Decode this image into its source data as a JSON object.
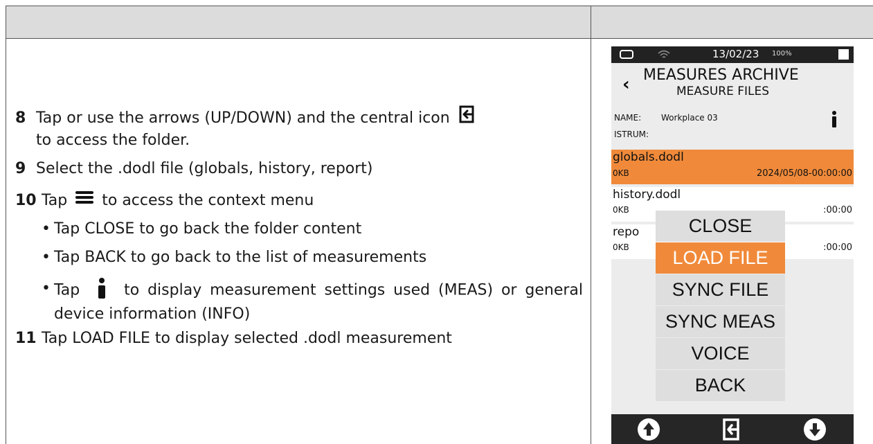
{
  "steps": [
    {
      "num": "8",
      "before": "Tap or use the arrows (UP/DOWN) and the central icon",
      "after": "to access the folder."
    },
    {
      "num": "9",
      "text": "Select the .dodl file (globals, history, report)"
    },
    {
      "num": "10",
      "before": "Tap",
      "after": "to access the context menu"
    },
    {
      "num": "11",
      "text": "Tap LOAD FILE to display selected .dodl measurement"
    }
  ],
  "substeps": {
    "close": "Tap CLOSE to go back the folder content",
    "back": "Tap BACK to go back to the list of measurements",
    "info_before": "Tap",
    "info_after": "to display measurement settings used (MEAS) or general device information (INFO)"
  },
  "device": {
    "status_date": "13/02/23",
    "status_battery": "100%",
    "title": "MEASURES ARCHIVE",
    "subtitle": "MEASURE FILES",
    "name_label": "NAME:",
    "name_value": "Workplace 03",
    "istrum_label": "ISTRUM:",
    "files": [
      {
        "name": "globals.dodl",
        "size": "0KB",
        "date": "2024/05/08-00:00:00"
      },
      {
        "name": "history.dodl",
        "size": "0KB",
        "date": ":00:00"
      },
      {
        "name": "repo",
        "size": "0KB",
        "date": ":00:00"
      }
    ],
    "menu": [
      "CLOSE",
      "LOAD FILE",
      "SYNC FILE",
      "SYNC MEAS",
      "VOICE",
      "BACK"
    ],
    "colors": {
      "accent": "#f08a3a",
      "bar": "#262626"
    }
  }
}
